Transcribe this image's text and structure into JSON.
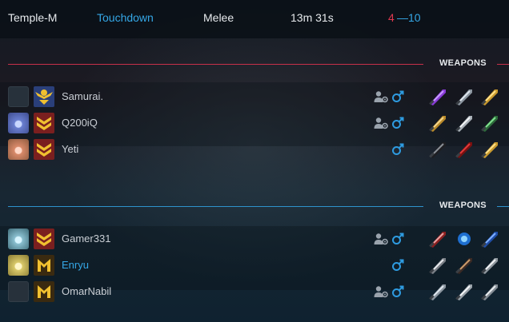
{
  "match": {
    "map": "Temple-M",
    "mode": "Touchdown",
    "type": "Melee",
    "duration": "13m 31s",
    "score_red": "4",
    "score_sep": "—",
    "score_blue": "10"
  },
  "colors": {
    "red_team": "#c7304a",
    "blue_team": "#2e93cc",
    "highlight": "#35a7e6"
  },
  "red_team": {
    "header_label": "WEAPONS",
    "players": [
      {
        "name": "Samurai.",
        "prestige_icon": "none",
        "rank_icon": "gold-wings-emblem-icon",
        "show_friend_icon": true,
        "weapons": [
          "purple-blade-icon",
          "silver-launcher-icon",
          "golden-blade-icon"
        ]
      },
      {
        "name": "Q200iQ",
        "prestige_icon": "blue-stopwatch-icon",
        "rank_icon": "chevron-rank-icon",
        "show_friend_icon": true,
        "weapons": [
          "golden-knife-icon",
          "curved-sword-icon",
          "green-blade-icon"
        ]
      },
      {
        "name": "Yeti",
        "prestige_icon": "tan-stopwatch-icon",
        "rank_icon": "chevron-rank-icon",
        "show_friend_icon": false,
        "weapons": [
          "dark-knife-icon",
          "red-claw-icon",
          "golden-blade-icon"
        ]
      }
    ]
  },
  "blue_team": {
    "header_label": "WEAPONS",
    "players": [
      {
        "name": "Gamer331",
        "prestige_icon": "cyan-stopwatch-icon",
        "rank_icon": "chevron-rank-icon",
        "show_friend_icon": true,
        "highlight": false,
        "weapons": [
          "red-dagger-icon",
          "blue-orb-icon",
          "blue-blade-icon"
        ]
      },
      {
        "name": "Enryu",
        "prestige_icon": "yellow-headphones-icon",
        "rank_icon": "m-emblem-icon",
        "show_friend_icon": false,
        "highlight": true,
        "weapons": [
          "spiked-blade-icon",
          "dark-mace-icon",
          "silver-blade-icon"
        ]
      },
      {
        "name": "OmarNabil",
        "prestige_icon": "none",
        "rank_icon": "m-emblem-icon",
        "show_friend_icon": true,
        "highlight": false,
        "weapons": [
          "silver-launcher-icon",
          "silver-sword-icon",
          "silver-knife-icon"
        ]
      }
    ]
  }
}
